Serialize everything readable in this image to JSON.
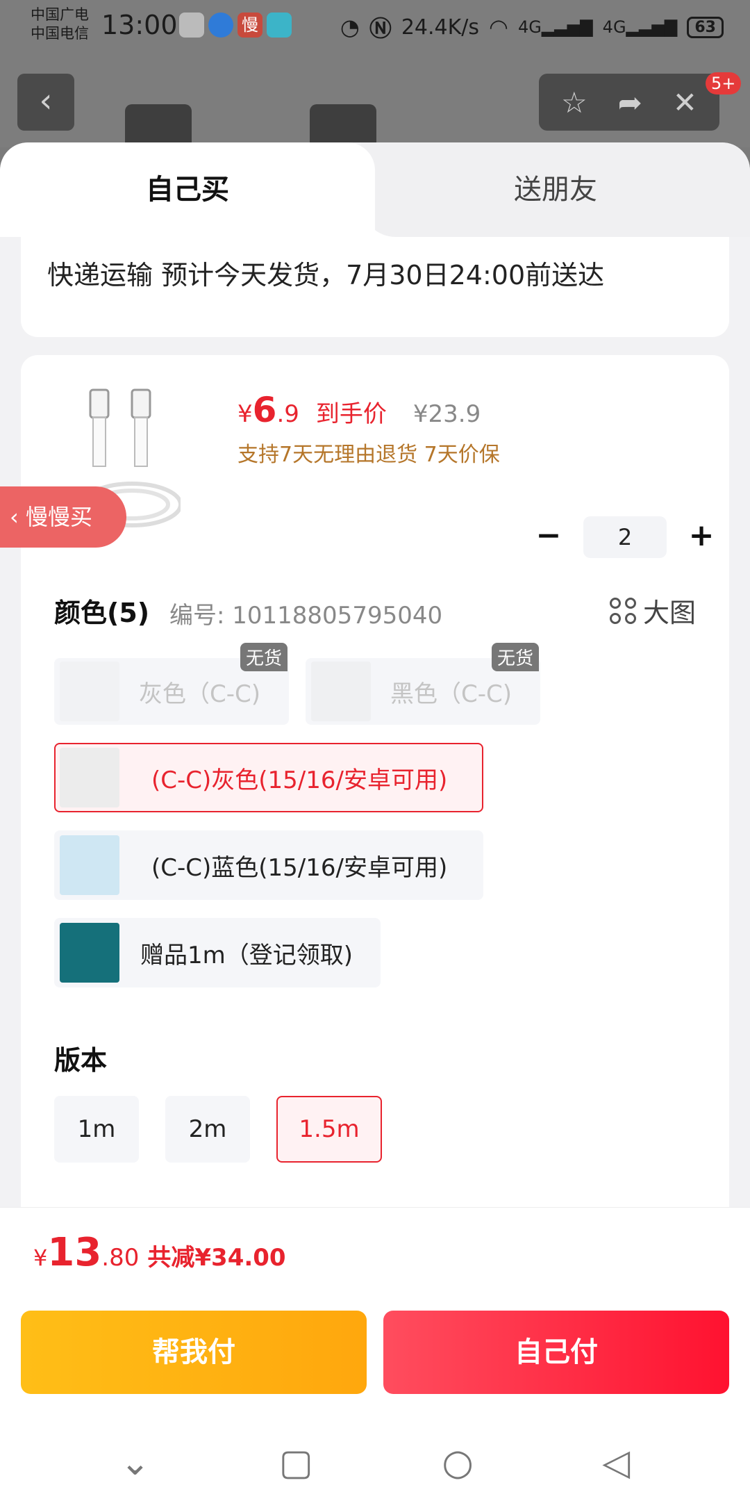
{
  "status_bar": {
    "carrier_line1": "中国广电",
    "carrier_line2": "中国电信",
    "time": "13:00",
    "app_icon_slow": "慢",
    "network_speed": "24.4K/s",
    "signal_label_1": "4G",
    "signal_label_2": "4G",
    "battery": "63"
  },
  "header": {
    "cart_badge": "5+"
  },
  "tabs": {
    "self_buy": "自己买",
    "gift_friend": "送朋友"
  },
  "shipping": {
    "text": "快递运输 预计今天发货，7月30日24:00前送达"
  },
  "product": {
    "currency": "¥",
    "price_integer": "6",
    "price_decimal": ".9",
    "price_label": "到手价",
    "original_price": "¥23.9",
    "guarantee": "支持7天无理由退货  7天价保",
    "quantity": "2"
  },
  "floating": {
    "slow_buy": "慢慢买"
  },
  "color_section": {
    "title": "颜色(5)",
    "sku_code": "编号: 10118805795040",
    "big_image": "大图",
    "no_stock_label": "无货",
    "options": [
      {
        "label": "灰色（C-C)",
        "state": "disabled"
      },
      {
        "label": "黑色（C-C)",
        "state": "disabled"
      },
      {
        "label": "(C-C)灰色(15/16/安卓可用)",
        "state": "selected"
      },
      {
        "label": "(C-C)蓝色(15/16/安卓可用)",
        "state": "normal"
      },
      {
        "label": "赠品1m（登记领取)",
        "state": "normal"
      }
    ]
  },
  "version_section": {
    "title": "版本",
    "options": [
      {
        "label": "1m",
        "state": "normal"
      },
      {
        "label": "2m",
        "state": "normal"
      },
      {
        "label": "1.5m",
        "state": "selected"
      }
    ]
  },
  "checkout": {
    "currency": "¥",
    "total_integer": "13",
    "total_decimal": ".80",
    "savings": "共减¥34.00",
    "help_pay": "帮我付",
    "self_pay": "自己付"
  },
  "colors": {
    "accent_red": "#e8232e",
    "gold_text": "#b5762a",
    "help_button": "#ffb312",
    "pay_button": "#ff2a40"
  }
}
